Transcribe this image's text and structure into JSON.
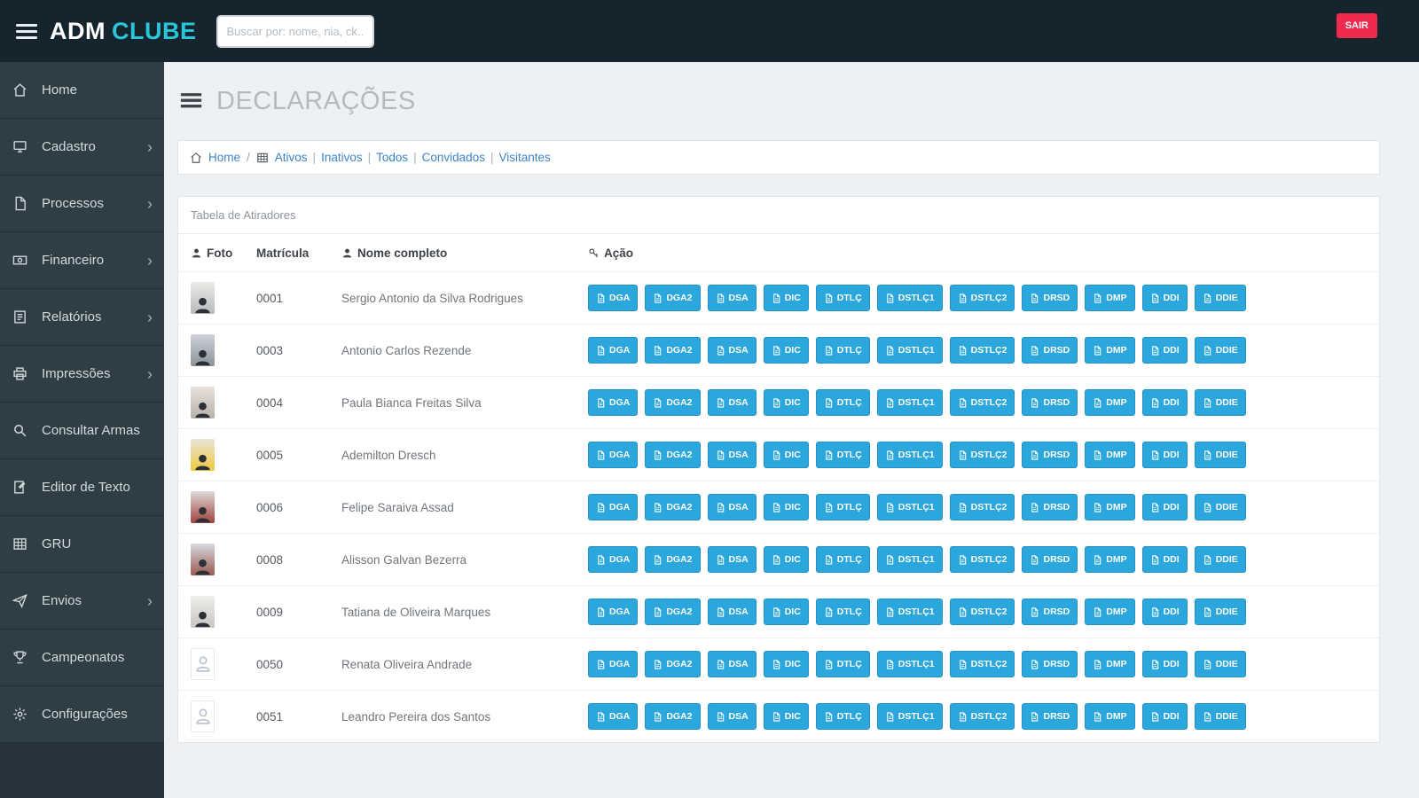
{
  "colors": {
    "topbar_bg": "#16242d",
    "sidebar_bg": "#2f3d45",
    "accent_cyan": "#29c5d8",
    "logout_red": "#ee2b4e",
    "button_blue": "#2ba7dd",
    "link_blue": "#3d83c4"
  },
  "topbar": {
    "logo_primary": "ADM",
    "logo_accent": "CLUBE",
    "search_placeholder": "Buscar por: nome, nia, ck...",
    "logout_label": "SAIR"
  },
  "sidebar": {
    "items": [
      {
        "label": "Home",
        "icon": "home",
        "has_submenu": false
      },
      {
        "label": "Cadastro",
        "icon": "monitor",
        "has_submenu": true
      },
      {
        "label": "Processos",
        "icon": "file",
        "has_submenu": true
      },
      {
        "label": "Financeiro",
        "icon": "money",
        "has_submenu": true
      },
      {
        "label": "Relatórios",
        "icon": "report",
        "has_submenu": true
      },
      {
        "label": "Impressões",
        "icon": "printer",
        "has_submenu": true
      },
      {
        "label": "Consultar Armas",
        "icon": "search",
        "has_submenu": false
      },
      {
        "label": "Editor de Texto",
        "icon": "edit",
        "has_submenu": false
      },
      {
        "label": "GRU",
        "icon": "grid",
        "has_submenu": false
      },
      {
        "label": "Envios",
        "icon": "send",
        "has_submenu": true
      },
      {
        "label": "Campeonatos",
        "icon": "trophy",
        "has_submenu": false
      },
      {
        "label": "Configurações",
        "icon": "gear",
        "has_submenu": false
      }
    ]
  },
  "page": {
    "title": "DECLARAÇÕES",
    "breadcrumb": {
      "home": "Home",
      "links": [
        "Ativos",
        "Inativos",
        "Todos",
        "Convidados",
        "Visitantes"
      ]
    },
    "panel": {
      "title": "Tabela de Atiradores"
    },
    "table": {
      "headers": {
        "foto": "Foto",
        "matricula": "Matrícula",
        "nome": "Nome completo",
        "acao": "Ação"
      },
      "action_buttons": [
        "DGA",
        "DGA2",
        "DSA",
        "DIC",
        "DTLÇ",
        "DSTLÇ1",
        "DSTLÇ2",
        "DRSD",
        "DMP",
        "DDI",
        "DDIE"
      ],
      "rows": [
        {
          "matricula": "0001",
          "nome": "Sergio Antonio da Silva Rodrigues",
          "has_photo": true
        },
        {
          "matricula": "0003",
          "nome": "Antonio Carlos Rezende",
          "has_photo": true
        },
        {
          "matricula": "0004",
          "nome": "Paula Bianca Freitas Silva",
          "has_photo": true
        },
        {
          "matricula": "0005",
          "nome": "Ademilton Dresch",
          "has_photo": true
        },
        {
          "matricula": "0006",
          "nome": "Felipe Saraiva Assad",
          "has_photo": true
        },
        {
          "matricula": "0008",
          "nome": "Alisson Galvan Bezerra",
          "has_photo": true
        },
        {
          "matricula": "0009",
          "nome": "Tatiana de Oliveira Marques",
          "has_photo": true
        },
        {
          "matricula": "0050",
          "nome": "Renata Oliveira Andrade",
          "has_photo": false
        },
        {
          "matricula": "0051",
          "nome": "Leandro Pereira dos Santos",
          "has_photo": false
        }
      ]
    }
  }
}
